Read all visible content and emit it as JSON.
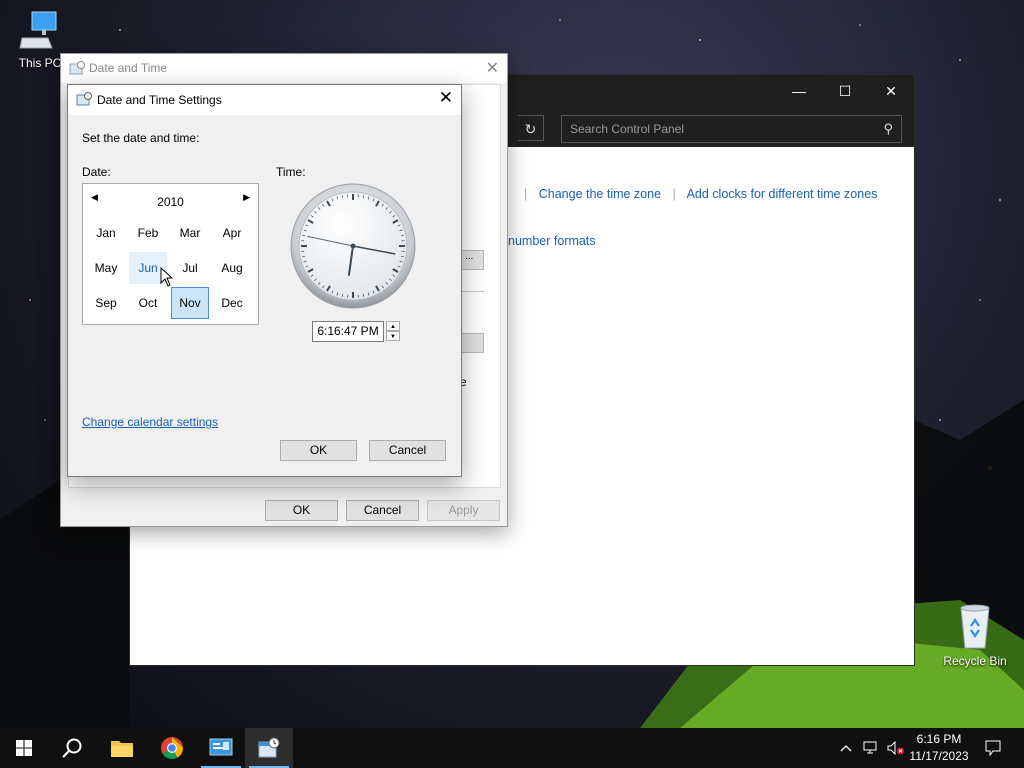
{
  "desktop": {
    "icons": [
      {
        "label": "This PC"
      },
      {
        "label": "Recycle Bin"
      }
    ]
  },
  "control_panel": {
    "search_placeholder": "Search Control Panel",
    "link_change_time_zone": "Change the time zone",
    "link_add_clocks": "Add clocks for different time zones",
    "link_number_formats": "number formats",
    "minimize_glyph": "—",
    "maximize_glyph": "☐",
    "close_glyph": "✕"
  },
  "date_time_dialog": {
    "title": "Date and Time",
    "buttons": {
      "ok": "OK",
      "cancel": "Cancel",
      "apply": "Apply"
    },
    "behind_fragment": "e"
  },
  "settings_dialog": {
    "title": "Date and Time Settings",
    "heading": "Set the date and time:",
    "date_label": "Date:",
    "time_label": "Time:",
    "calendar": {
      "year": "2010",
      "months": [
        "Jan",
        "Feb",
        "Mar",
        "Apr",
        "May",
        "Jun",
        "Jul",
        "Aug",
        "Sep",
        "Oct",
        "Nov",
        "Dec"
      ],
      "selected_month": "Nov",
      "hovered_month": "Jun"
    },
    "time_value": "6:16:47 PM",
    "clock": {
      "hour": 6,
      "minute": 16,
      "second": 47
    },
    "change_calendar_link": "Change calendar settings",
    "buttons": {
      "ok": "OK",
      "cancel": "Cancel"
    }
  },
  "taskbar": {
    "time": "6:16 PM",
    "date": "11/17/2023"
  },
  "colors": {
    "link": "#1a5fb4",
    "selection": "#cce4f7",
    "taskbar": "#101010"
  }
}
